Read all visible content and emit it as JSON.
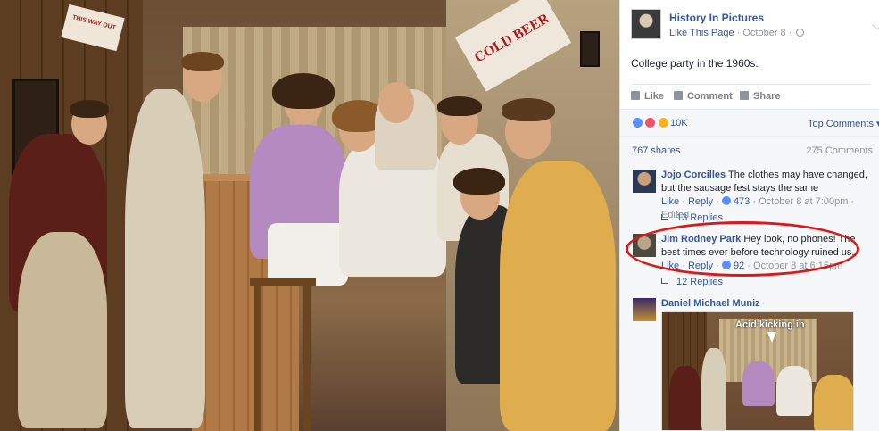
{
  "photo": {
    "sign_left": "THIS WAY OUT",
    "sign_right": "COLD BEER"
  },
  "post": {
    "page_name": "History In Pictures",
    "like_page": "Like This Page",
    "date": "October 8",
    "caption": "College party in the 1960s.",
    "actions": [
      "Like",
      "Comment",
      "Share"
    ],
    "reactions_count": "10K",
    "top_comments": "Top Comments",
    "shares": "767 shares",
    "comments_count": "275 Comments"
  },
  "comments": [
    {
      "name": "Jojo Corcilles",
      "text": "The clothes may have changed, but the sausage fest stays the same",
      "like": "Like",
      "reply": "Reply",
      "likes": "473",
      "time": "October 8 at 7:00pm",
      "edited": "Edited",
      "replies": "13 Replies"
    },
    {
      "name": "Jim Rodney Park",
      "text": "Hey look, no phones! The best times ever before technology ruined us.",
      "like": "Like",
      "reply": "Reply",
      "likes": "92",
      "time": "October 8 at 6:15pm",
      "replies": "12 Replies"
    },
    {
      "name": "Daniel Michael Muniz",
      "image_label": "Acid kicking in"
    }
  ],
  "colors": {
    "link": "#365899",
    "highlight": "#d91a1a",
    "meta": "#90949c"
  }
}
